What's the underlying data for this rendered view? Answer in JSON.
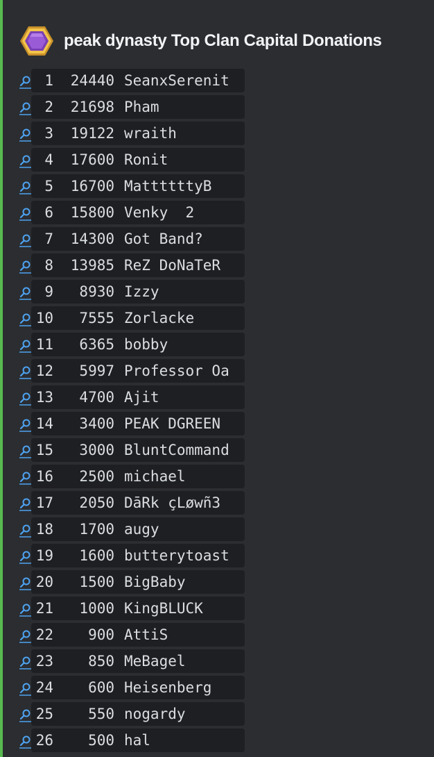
{
  "embed": {
    "accent_color": "#57b94f",
    "author_icon": "clan-capital-hexagon-icon",
    "title": "peak dynasty Top Clan Capital Donations"
  },
  "rows": [
    {
      "rank": "1",
      "amount": "24440",
      "name": "SeanxSerenit"
    },
    {
      "rank": "2",
      "amount": "21698",
      "name": "Pham"
    },
    {
      "rank": "3",
      "amount": "19122",
      "name": "wraith"
    },
    {
      "rank": "4",
      "amount": "17600",
      "name": "Ronit"
    },
    {
      "rank": "5",
      "amount": "16700",
      "name": "MattttttyB"
    },
    {
      "rank": "6",
      "amount": "15800",
      "name": "Venky  2"
    },
    {
      "rank": "7",
      "amount": "14300",
      "name": "Got Band?"
    },
    {
      "rank": "8",
      "amount": "13985",
      "name": "ReZ DoNaTeR"
    },
    {
      "rank": "9",
      "amount": "8930",
      "name": "Izzy"
    },
    {
      "rank": "10",
      "amount": "7555",
      "name": "Zorlacke"
    },
    {
      "rank": "11",
      "amount": "6365",
      "name": "bobby"
    },
    {
      "rank": "12",
      "amount": "5997",
      "name": "Professor Oa"
    },
    {
      "rank": "13",
      "amount": "4700",
      "name": "Ajit"
    },
    {
      "rank": "14",
      "amount": "3400",
      "name": "PEAK DGREEN"
    },
    {
      "rank": "15",
      "amount": "3000",
      "name": "BluntCommand"
    },
    {
      "rank": "16",
      "amount": "2500",
      "name": "michael"
    },
    {
      "rank": "17",
      "amount": "2050",
      "name": "DāRk çLøwñ3"
    },
    {
      "rank": "18",
      "amount": "1700",
      "name": "augy"
    },
    {
      "rank": "19",
      "amount": "1600",
      "name": "butterytoast"
    },
    {
      "rank": "20",
      "amount": "1500",
      "name": "BigBaby"
    },
    {
      "rank": "21",
      "amount": "1000",
      "name": "KingBLUCK"
    },
    {
      "rank": "22",
      "amount": "900",
      "name": "AttiS"
    },
    {
      "rank": "23",
      "amount": "850",
      "name": "MeBagel"
    },
    {
      "rank": "24",
      "amount": "600",
      "name": "Heisenberg"
    },
    {
      "rank": "25",
      "amount": "550",
      "name": "nogardy"
    },
    {
      "rank": "26",
      "amount": "500",
      "name": "hal"
    }
  ],
  "row_icon": "magnifier-icon",
  "link_color": "#4ea3f1"
}
